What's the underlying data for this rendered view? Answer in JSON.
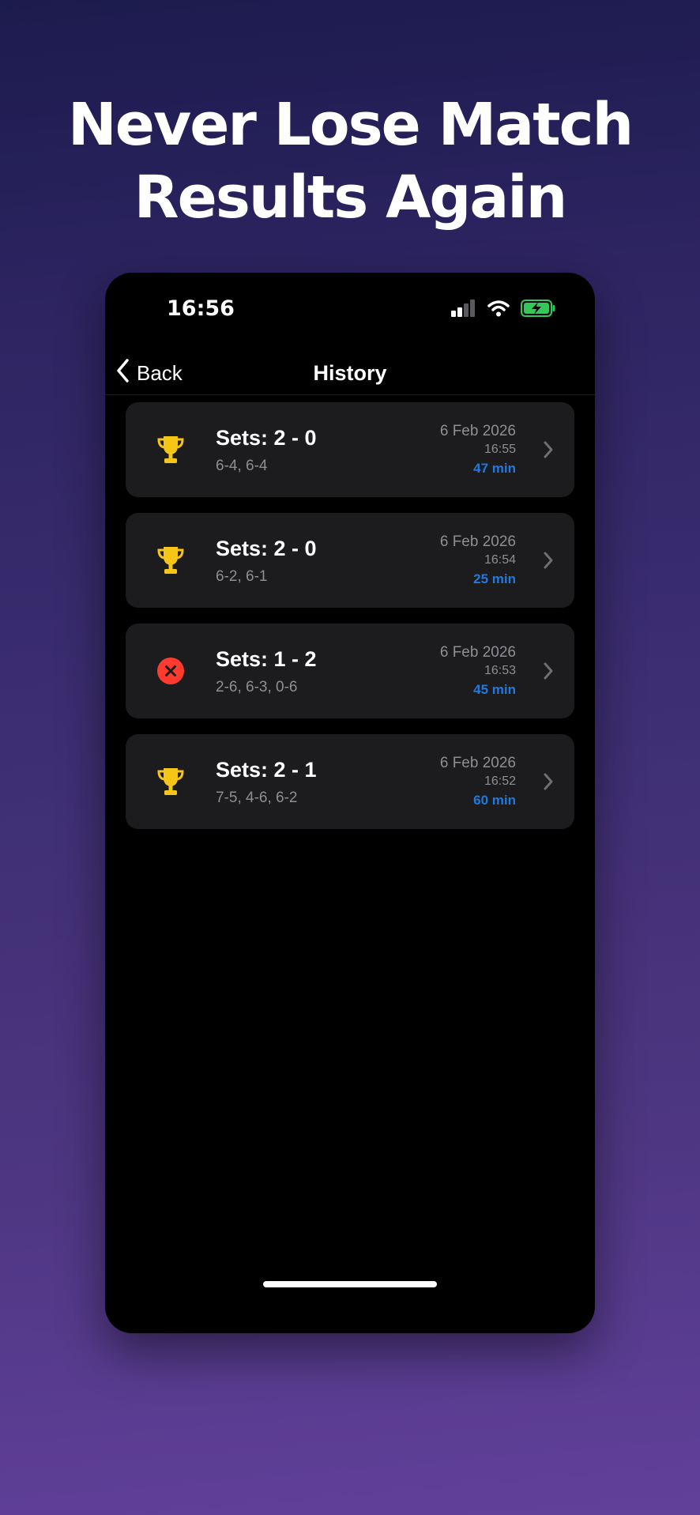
{
  "headline": {
    "line1": "Never Lose Match",
    "line2": "Results Again"
  },
  "status_bar": {
    "time": "16:56",
    "icons": [
      "cellular-signal-icon",
      "wifi-icon",
      "battery-charging-icon"
    ],
    "battery_color": "#34c759"
  },
  "nav": {
    "back_label": "Back",
    "title": "History"
  },
  "colors": {
    "trophy": "#f5c518",
    "loss": "#ff3b30",
    "duration": "#1e7ae0",
    "card": "#1c1c1e"
  },
  "matches": [
    {
      "result": "win",
      "icon": "trophy-icon",
      "title": "Sets: 2 - 0",
      "scores": "6-4, 6-4",
      "date": "6 Feb 2026",
      "time": "16:55",
      "duration": "47 min"
    },
    {
      "result": "win",
      "icon": "trophy-icon",
      "title": "Sets: 2 - 0",
      "scores": "6-2, 6-1",
      "date": "6 Feb 2026",
      "time": "16:54",
      "duration": "25 min"
    },
    {
      "result": "loss",
      "icon": "loss-x-icon",
      "title": "Sets: 1 - 2",
      "scores": "2-6, 6-3, 0-6",
      "date": "6 Feb 2026",
      "time": "16:53",
      "duration": "45 min"
    },
    {
      "result": "win",
      "icon": "trophy-icon",
      "title": "Sets: 2 - 1",
      "scores": "7-5, 4-6, 6-2",
      "date": "6 Feb 2026",
      "time": "16:52",
      "duration": "60 min"
    }
  ]
}
